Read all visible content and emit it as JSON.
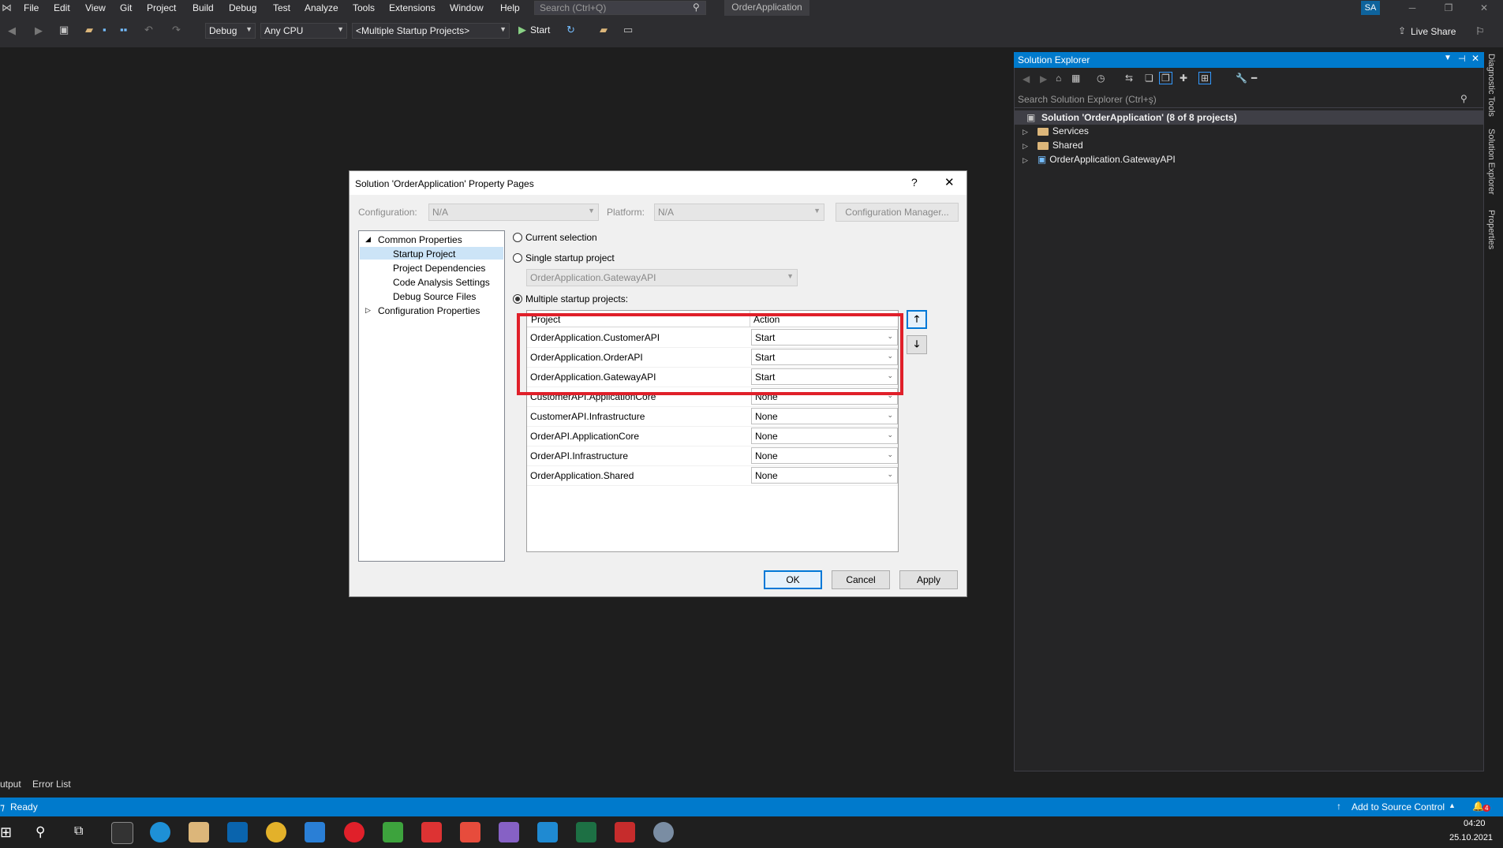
{
  "menu": [
    "File",
    "Edit",
    "View",
    "Git",
    "Project",
    "Build",
    "Debug",
    "Test",
    "Analyze",
    "Tools",
    "Extensions",
    "Window",
    "Help"
  ],
  "search_placeholder": "Search (Ctrl+Q)",
  "app_title": "OrderApplication",
  "user_initials": "SA",
  "toolbar": {
    "config": "Debug",
    "platform": "Any CPU",
    "startup": "<Multiple Startup Projects>",
    "start_label": "Start",
    "live_share": "Live Share"
  },
  "solution_explorer": {
    "title": "Solution Explorer",
    "search_placeholder": "Search Solution Explorer (Ctrl+ş)",
    "solution_label": "Solution 'OrderApplication' (8 of 8 projects)",
    "items": [
      "Services",
      "Shared",
      "OrderApplication.GatewayAPI"
    ]
  },
  "side_tabs": [
    "Diagnostic Tools",
    "Solution Explorer",
    "Properties"
  ],
  "bottom_tabs": [
    "utput",
    "Error List"
  ],
  "status": {
    "text": "Ready",
    "source_control": "Add to Source Control",
    "notifications": "4"
  },
  "clock": {
    "time": "04:20",
    "date": "25.10.2021"
  },
  "dialog": {
    "title": "Solution 'OrderApplication' Property Pages",
    "help": "?",
    "close": "✕",
    "configuration_label": "Configuration:",
    "configuration_value": "N/A",
    "platform_label": "Platform:",
    "platform_value": "N/A",
    "config_manager": "Configuration Manager...",
    "tree": {
      "common": "Common Properties",
      "children": [
        "Startup Project",
        "Project Dependencies",
        "Code Analysis Settings",
        "Debug Source Files"
      ],
      "config": "Configuration Properties"
    },
    "options": {
      "current": "Current selection",
      "single": "Single startup project",
      "single_value": "OrderApplication.GatewayAPI",
      "multiple": "Multiple startup projects:"
    },
    "grid_headers": {
      "project": "Project",
      "action": "Action"
    },
    "rows": [
      {
        "project": "OrderApplication.CustomerAPI",
        "action": "Start"
      },
      {
        "project": "OrderApplication.OrderAPI",
        "action": "Start"
      },
      {
        "project": "OrderApplication.GatewayAPI",
        "action": "Start"
      },
      {
        "project": "CustomerAPI.ApplicationCore",
        "action": "None"
      },
      {
        "project": "CustomerAPI.Infrastructure",
        "action": "None"
      },
      {
        "project": "OrderAPI.ApplicationCore",
        "action": "None"
      },
      {
        "project": "OrderAPI.Infrastructure",
        "action": "None"
      },
      {
        "project": "OrderApplication.Shared",
        "action": "None"
      }
    ],
    "buttons": {
      "ok": "OK",
      "cancel": "Cancel",
      "apply": "Apply"
    }
  }
}
